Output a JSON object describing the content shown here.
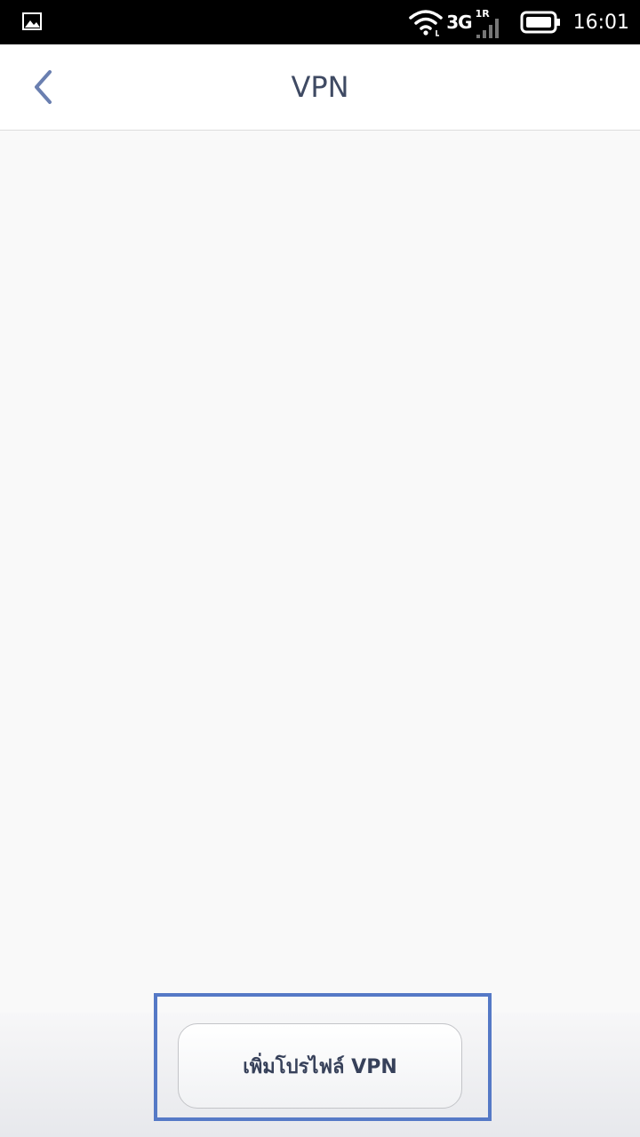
{
  "status_bar": {
    "network_type": "3G",
    "sim_badge": "1R",
    "time": "16:01",
    "icons": [
      "gallery-icon",
      "wifi-icon",
      "signal-icon",
      "battery-icon"
    ]
  },
  "header": {
    "title": "VPN",
    "back_icon": "chevron-left-icon"
  },
  "footer": {
    "add_button_label": "เพิ่มโปรไฟล์ VPN"
  },
  "colors": {
    "accent": "#6a7fb0",
    "title": "#3f4a63",
    "highlight": "#5579c6",
    "background": "#f9f9f9"
  }
}
